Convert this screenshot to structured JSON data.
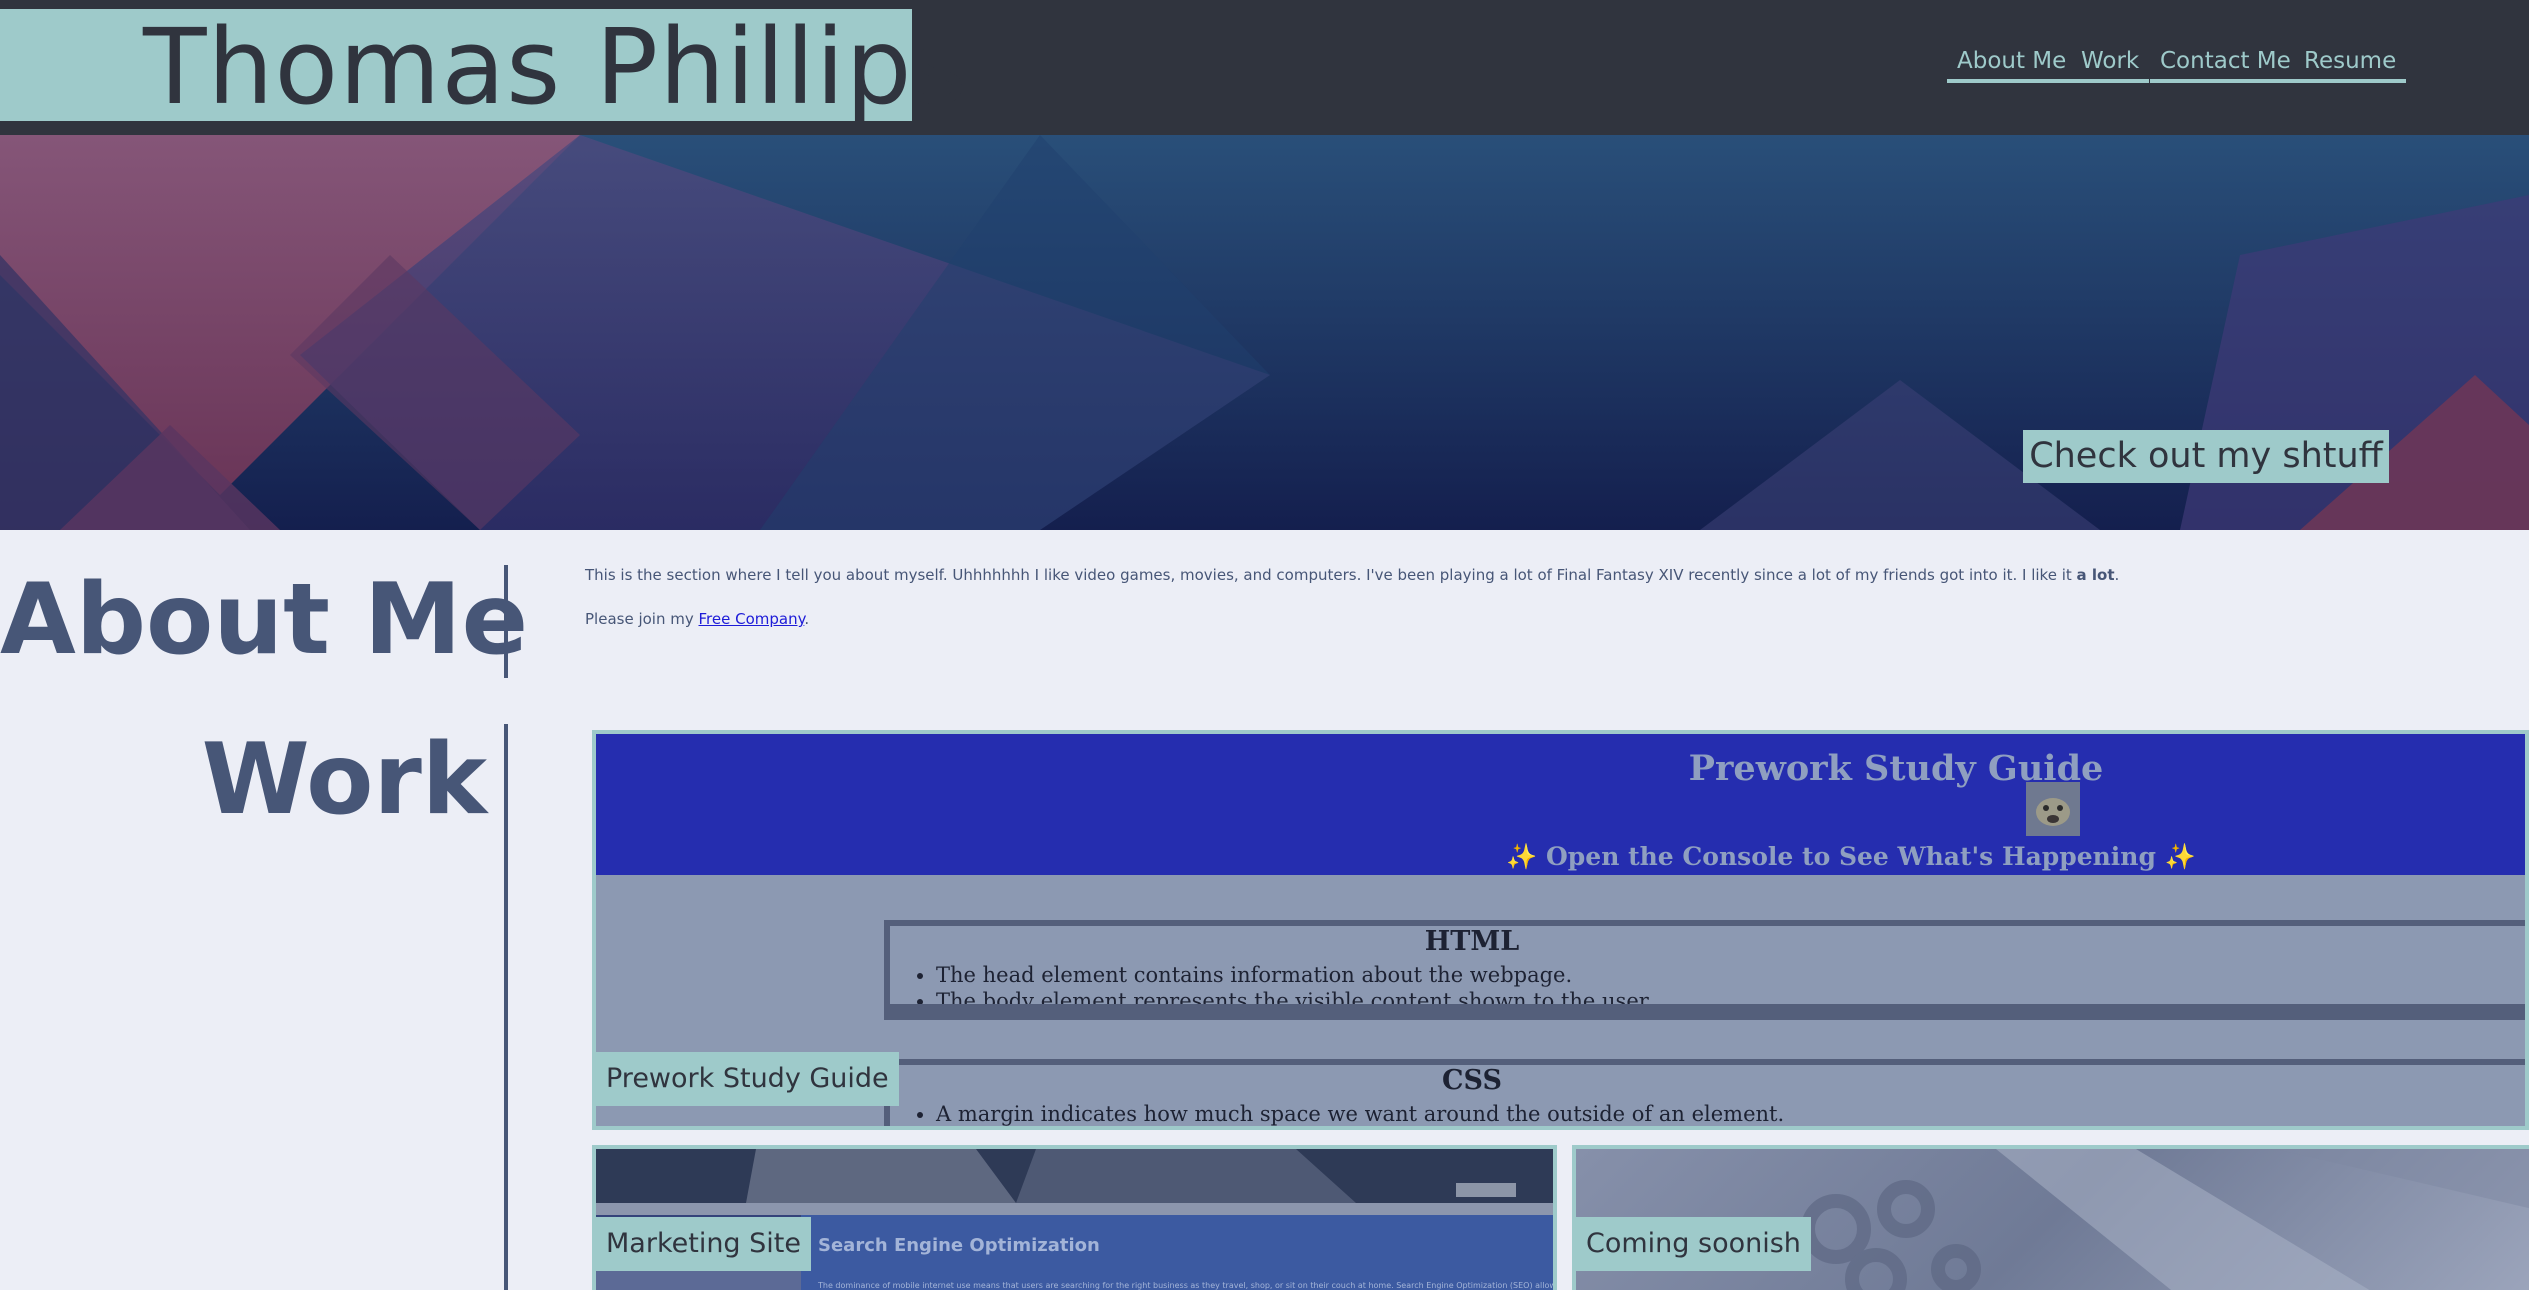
{
  "header": {
    "name": "Thomas Phillips",
    "nav": [
      "About Me",
      "Work",
      "Contact Me",
      "Resume"
    ]
  },
  "hero": {
    "button_label": "Check out my shtuff"
  },
  "about": {
    "title": "About Me",
    "paragraph_main": "This is the section where I tell you about myself. Uhhhhhhh I like video games, movies, and computers. I've been playing a lot of Final Fantasy XIV recently since a lot of my friends got into it. I like it ",
    "paragraph_emphasis": "a lot",
    "paragraph_end": ".",
    "join_prefix": "Please join my ",
    "join_link": "Free Company",
    "join_suffix": "."
  },
  "work": {
    "title": "Work",
    "prework": {
      "label": "Prework Study Guide",
      "page_title": "Prework Study Guide",
      "page_subtitle": "✨ Open the Console to See What's Happening ✨",
      "sections": [
        {
          "heading": "HTML",
          "items": [
            "The head element contains information about the webpage.",
            "The body element represents the visible content shown to the user."
          ]
        },
        {
          "heading": "CSS",
          "items": [
            "A margin indicates how much space we want around the outside of an element."
          ]
        }
      ]
    },
    "marketing": {
      "label": "Marketing Site",
      "heading": "Search Engine Optimization",
      "body": "The dominance of mobile internet use means that users are searching for the right business as they travel, shop, or sit on their couch at home. Search Engine Optimization (SEO) allows you to increase"
    },
    "coming": {
      "label": "Coming soonish"
    }
  },
  "colors": {
    "header_bg": "#30343e",
    "accent": "#9ecaca",
    "page_bg": "#eceef6",
    "heading_text": "#475677",
    "link": "#1d1bd8"
  }
}
